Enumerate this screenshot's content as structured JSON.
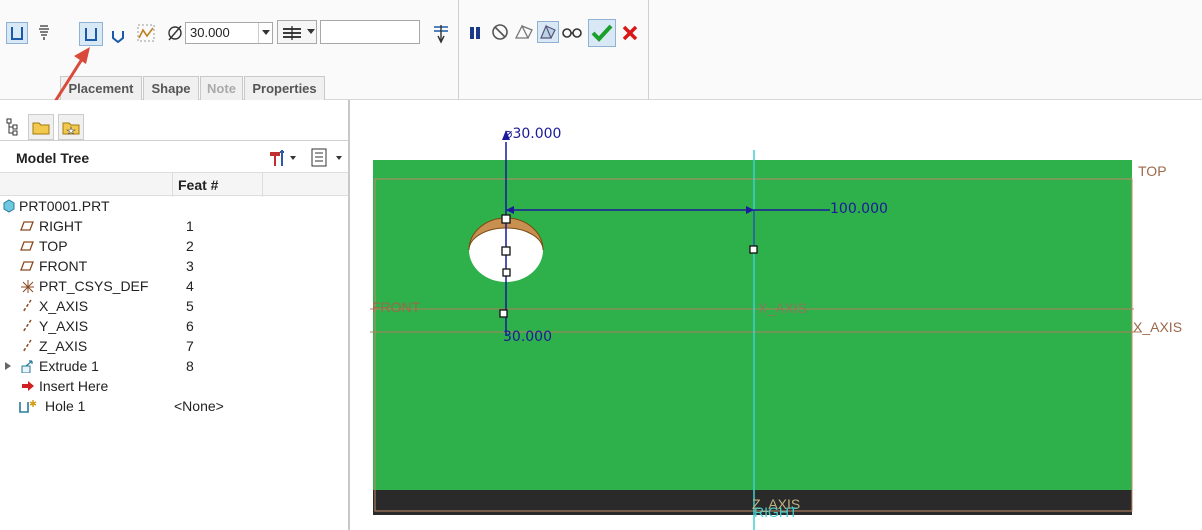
{
  "dashboard": {
    "diameter_value": "30.000",
    "depth_value": "",
    "tabs": [
      {
        "label": "Placement",
        "enabled": true
      },
      {
        "label": "Shape",
        "enabled": true
      },
      {
        "label": "Note",
        "enabled": false
      },
      {
        "label": "Properties",
        "enabled": true
      }
    ],
    "colors": {
      "ok": "#1aa02a",
      "cancel": "#d81818",
      "pause": "#1a3a8a"
    }
  },
  "model_tree": {
    "title": "Model Tree",
    "column_header": "Feat #",
    "root": "PRT0001.PRT",
    "items": [
      {
        "name": "RIGHT",
        "feat": "1",
        "icon": "datum-plane-icon"
      },
      {
        "name": "TOP",
        "feat": "2",
        "icon": "datum-plane-icon"
      },
      {
        "name": "FRONT",
        "feat": "3",
        "icon": "datum-plane-icon"
      },
      {
        "name": "PRT_CSYS_DEF",
        "feat": "4",
        "icon": "csys-icon"
      },
      {
        "name": "X_AXIS",
        "feat": "5",
        "icon": "datum-axis-icon"
      },
      {
        "name": "Y_AXIS",
        "feat": "6",
        "icon": "datum-axis-icon"
      },
      {
        "name": "Z_AXIS",
        "feat": "7",
        "icon": "datum-axis-icon"
      },
      {
        "name": "Extrude 1",
        "feat": "8",
        "icon": "extrude-icon"
      },
      {
        "name": "Insert Here",
        "feat": "",
        "icon": "insert-arrow-icon"
      },
      {
        "name": "Hole 1",
        "feat": "<None>",
        "icon": "hole-icon"
      }
    ]
  },
  "graphics": {
    "dim_diameter": "30.000",
    "dim_horizontal": "100.000",
    "dim_vertical": "30.000",
    "datum_labels": {
      "top": "TOP",
      "front": "FRONT",
      "x_axis": "X_AXIS",
      "x_axis_inner": "X_AXIS",
      "z_axis": "Z_AXIS",
      "right": "RIGHT"
    },
    "colors": {
      "part": "#2eb04a",
      "part_bottom": "#2a2a2a",
      "dimension": "#1a1a9a",
      "datum": "#9a6a4a",
      "axis": "#40d0d0"
    }
  }
}
